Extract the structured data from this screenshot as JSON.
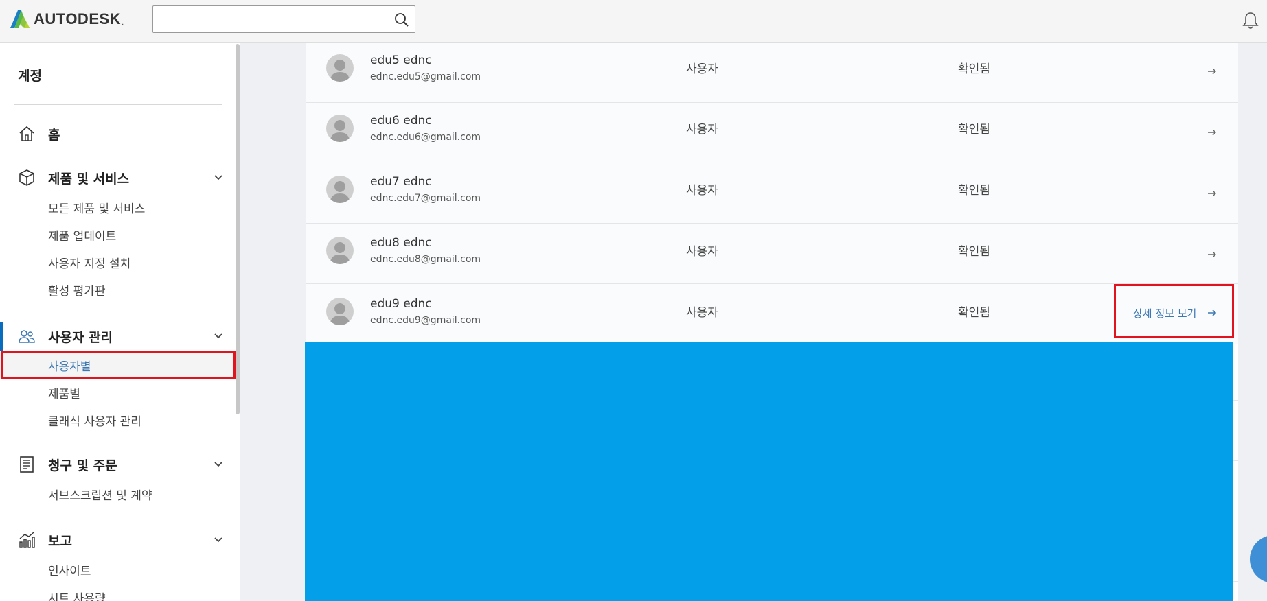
{
  "header": {
    "logo_text": "AUTODESK",
    "logo_mark": ".",
    "search": {
      "value": "",
      "placeholder": ""
    },
    "colors": {
      "logo_a1": "#1b7fc4",
      "logo_a2": "#58b947",
      "logo_a3": "#b8d432"
    }
  },
  "sidebar": {
    "title": "계정",
    "sections": [
      {
        "label": "홈",
        "icon": "home-icon",
        "items": []
      },
      {
        "label": "제품 및 서비스",
        "icon": "cube-icon",
        "items": [
          "모든 제품 및 서비스",
          "제품 업데이트",
          "사용자 지정 설치",
          "활성 평가판"
        ]
      },
      {
        "label": "사용자 관리",
        "icon": "users-icon",
        "items": [
          "사용자별",
          "제품별",
          "클래식 사용자 관리"
        ],
        "active_item": "사용자별"
      },
      {
        "label": "청구 및 주문",
        "icon": "invoice-icon",
        "items": [
          "서브스크립션 및 계약"
        ]
      },
      {
        "label": "보고",
        "icon": "chart-icon",
        "items": [
          "인사이트",
          "시트 사용량"
        ]
      }
    ]
  },
  "users": [
    {
      "name": "edu5 ednc",
      "email": "ednc.edu5@gmail.com",
      "role": "사용자",
      "status": "확인됨"
    },
    {
      "name": "edu6 ednc",
      "email": "ednc.edu6@gmail.com",
      "role": "사용자",
      "status": "확인됨"
    },
    {
      "name": "edu7 ednc",
      "email": "ednc.edu7@gmail.com",
      "role": "사용자",
      "status": "확인됨"
    },
    {
      "name": "edu8 ednc",
      "email": "ednc.edu8@gmail.com",
      "role": "사용자",
      "status": "확인됨"
    },
    {
      "name": "edu9 ednc",
      "email": "ednc.edu9@gmail.com",
      "role": "사용자",
      "status": "확인됨",
      "action_label": "상세 정보 보기"
    }
  ],
  "colors": {
    "accent": "#3c77b3",
    "highlight": "#e0141e",
    "overlay": "#039fe8"
  }
}
